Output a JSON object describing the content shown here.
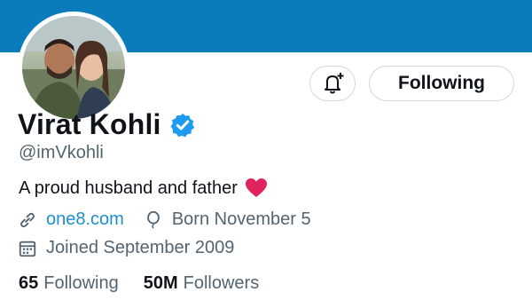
{
  "profile": {
    "name": "Virat Kohli",
    "handle": "@imVkohli",
    "bio": "A proud husband and father",
    "website": "one8.com",
    "birthday": "Born November 5",
    "joined": "Joined September 2009"
  },
  "actions": {
    "following_label": "Following"
  },
  "stats": {
    "following_count": "65",
    "following_label": "Following",
    "followers_count": "50M",
    "followers_label": "Followers"
  },
  "colors": {
    "banner": "#0a7cbc",
    "verified": "#1d9bf0",
    "link": "#1d8fce",
    "heart": "#e0245e"
  },
  "icons": {
    "bell": "notification-bell-plus-icon",
    "verified": "verified-badge-icon",
    "heart": "red-heart-emoji",
    "link": "link-icon",
    "birthday": "balloon-icon",
    "joined": "calendar-icon"
  }
}
